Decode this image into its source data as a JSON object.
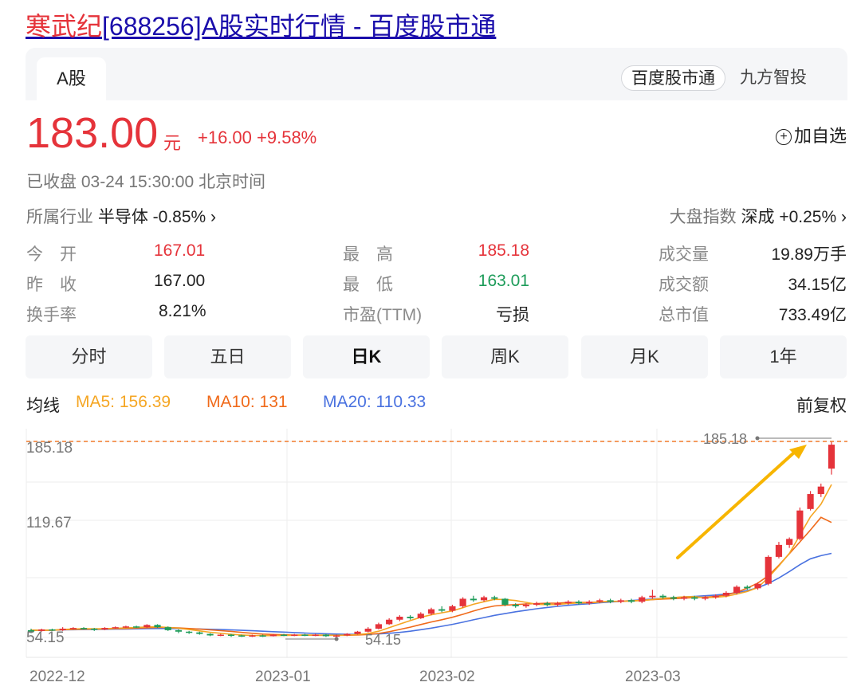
{
  "title": {
    "name": "寒武纪",
    "rest": "[688256]A股实时行情 - 百度股市通"
  },
  "tabs": {
    "active": "A股"
  },
  "sources": {
    "active": "百度股市通",
    "other": "九方智投"
  },
  "quote": {
    "price": "183.00",
    "unit": "元",
    "change": "+16.00 +9.58%",
    "add_watch": "加自选",
    "status": "已收盘  03-24 15:30:00  北京时间",
    "industry_label": "所属行业",
    "industry_value": "半导体 -0.85% ›",
    "index_label": "大盘指数",
    "index_value": "深成 +0.25% ›"
  },
  "stats": {
    "open_label": "今　开",
    "open": "167.01",
    "prev_label": "昨　收",
    "prev": "167.00",
    "turnover_label": "换手率",
    "turnover": "8.21%",
    "high_label": "最　高",
    "high": "185.18",
    "low_label": "最　低",
    "low": "163.01",
    "pe_label": "市盈(TTM)",
    "pe": "亏损",
    "volume_label": "成交量",
    "volume": "19.89万手",
    "amount_label": "成交额",
    "amount": "34.15亿",
    "mcap_label": "总市值",
    "mcap": "733.49亿"
  },
  "periods": [
    "分时",
    "五日",
    "日K",
    "周K",
    "月K",
    "1年"
  ],
  "active_period": "日K",
  "ma_legend": {
    "label": "均线",
    "ma5": "MA5: 156.39",
    "ma10": "MA10: 131",
    "ma20": "MA20: 110.33"
  },
  "adjust": "前复权",
  "colors": {
    "up": "#e5333a",
    "down": "#1e9c5a",
    "ma5": "#f5a623",
    "ma10": "#f06a1a",
    "ma20": "#4a72e0",
    "arrow": "#f7b500"
  },
  "chart_data": {
    "type": "candlestick",
    "y_ticks": [
      "185.18",
      "119.67",
      "54.15"
    ],
    "ylim": [
      54.15,
      185.18
    ],
    "x_ticks": [
      "2022-12",
      "2023-01",
      "2023-02",
      "2023-03"
    ],
    "max_label": "185.18",
    "min_label": "54.15",
    "candles": [
      [
        59,
        58,
        60,
        57
      ],
      [
        58.5,
        59.5,
        60,
        58
      ],
      [
        59.5,
        59,
        60,
        58.5
      ],
      [
        59,
        60,
        61,
        58.5
      ],
      [
        60,
        60.5,
        61,
        59.5
      ],
      [
        60.5,
        60,
        61,
        59.5
      ],
      [
        60,
        59.5,
        60.5,
        58.5
      ],
      [
        59.5,
        60.5,
        61,
        59
      ],
      [
        60.5,
        61,
        61.5,
        60
      ],
      [
        61,
        61.5,
        62,
        60.5
      ],
      [
        61.5,
        61,
        62,
        60.5
      ],
      [
        61,
        62.5,
        63,
        60.5
      ],
      [
        62.5,
        61,
        63,
        60.5
      ],
      [
        61,
        59,
        61.5,
        58.5
      ],
      [
        59,
        58,
        59.5,
        57
      ],
      [
        58,
        57.5,
        58.5,
        56.5
      ],
      [
        57.5,
        56.5,
        58,
        56
      ],
      [
        56.5,
        55.5,
        57,
        55
      ],
      [
        55.5,
        56,
        56.5,
        55
      ],
      [
        56,
        55.5,
        56.5,
        54.5
      ],
      [
        55.5,
        55,
        56,
        54.5
      ],
      [
        55,
        55.5,
        56,
        54.5
      ],
      [
        55.5,
        55,
        56,
        54.5
      ],
      [
        55,
        56,
        56.5,
        54.8
      ],
      [
        56,
        55.5,
        56.5,
        55
      ],
      [
        55.5,
        56,
        56.5,
        55
      ],
      [
        56,
        55.5,
        56.5,
        55
      ],
      [
        55.5,
        56,
        56.5,
        55
      ],
      [
        56,
        55,
        56.5,
        54.5
      ],
      [
        55,
        55.5,
        56,
        54.15
      ],
      [
        55.5,
        56.5,
        57,
        55
      ],
      [
        56.5,
        58,
        58.5,
        56
      ],
      [
        58,
        60,
        61,
        57.5
      ],
      [
        60,
        63,
        64,
        59.5
      ],
      [
        63,
        66,
        67,
        62.5
      ],
      [
        66,
        68,
        69,
        65
      ],
      [
        68,
        67,
        69,
        66
      ],
      [
        67,
        70,
        71,
        66.5
      ],
      [
        70,
        73,
        74,
        69
      ],
      [
        73,
        72,
        75,
        71
      ],
      [
        72,
        75,
        76,
        71
      ],
      [
        75,
        80,
        81,
        74
      ],
      [
        80,
        79,
        82,
        78
      ],
      [
        79,
        81,
        82,
        78
      ],
      [
        81,
        80,
        82,
        79
      ],
      [
        80,
        76,
        80.5,
        75
      ],
      [
        76,
        75,
        77,
        74
      ],
      [
        75,
        76,
        77,
        74
      ],
      [
        76,
        77,
        78,
        75
      ],
      [
        77,
        76,
        78,
        75
      ],
      [
        76,
        77,
        78,
        75
      ],
      [
        77,
        78,
        79,
        76
      ],
      [
        78,
        77,
        79,
        76
      ],
      [
        77,
        78,
        79,
        76
      ],
      [
        78,
        79,
        80,
        77
      ],
      [
        79,
        78,
        80,
        77
      ],
      [
        78,
        79,
        80,
        77
      ],
      [
        79,
        78,
        80,
        77
      ],
      [
        78,
        81,
        82,
        77
      ],
      [
        81,
        82,
        86,
        80
      ],
      [
        82,
        81,
        83,
        80
      ],
      [
        81,
        80,
        82,
        79
      ],
      [
        80,
        81,
        82,
        79
      ],
      [
        81,
        80,
        82,
        79
      ],
      [
        80,
        81,
        82,
        79
      ],
      [
        81,
        82,
        83,
        80
      ],
      [
        82,
        84,
        85,
        81
      ],
      [
        84,
        88,
        89,
        83
      ],
      [
        88,
        87,
        89,
        86
      ],
      [
        87,
        90,
        91,
        86
      ],
      [
        90,
        108,
        109,
        89
      ],
      [
        108,
        116,
        118,
        107
      ],
      [
        116,
        120,
        121,
        114
      ],
      [
        120,
        139,
        141,
        119
      ],
      [
        140,
        150,
        152,
        139
      ],
      [
        150,
        155,
        157,
        148
      ],
      [
        167,
        183,
        185.18,
        163
      ]
    ],
    "ma5": [
      59,
      59,
      59,
      59.5,
      59.8,
      60,
      59.9,
      60,
      60.2,
      60.5,
      60.8,
      61.2,
      61.3,
      60.8,
      60.3,
      59.4,
      58.5,
      57.6,
      56.9,
      56.3,
      55.8,
      55.5,
      55.4,
      55.4,
      55.5,
      55.6,
      55.7,
      55.7,
      55.7,
      55.6,
      55.7,
      56,
      56.8,
      58.3,
      60.7,
      63.1,
      65.4,
      67.6,
      69.3,
      70.6,
      71.9,
      74,
      76.3,
      78,
      79.6,
      79.5,
      78.8,
      77.6,
      76.3,
      76,
      76.2,
      76.8,
      77.2,
      77.2,
      77.8,
      78.2,
      78.4,
      78.6,
      78.8,
      79.5,
      80.3,
      80.8,
      81.3,
      81.4,
      80.7,
      81,
      81.6,
      83.1,
      84.9,
      87.5,
      94.1,
      101.9,
      110.4,
      122.6,
      134.8,
      143.2,
      156.39
    ],
    "ma10": [
      59,
      59,
      59,
      59.3,
      59.5,
      59.7,
      59.7,
      59.8,
      60,
      60.1,
      60.4,
      60.6,
      60.9,
      60.8,
      60.5,
      60.1,
      59.7,
      59.2,
      58.7,
      58.2,
      57.5,
      56.9,
      56.4,
      56.1,
      55.9,
      55.7,
      55.7,
      55.6,
      55.6,
      55.6,
      55.6,
      55.8,
      56.1,
      56.8,
      58,
      59.5,
      61,
      62.8,
      64.5,
      66,
      67.6,
      69.6,
      71.8,
      73.8,
      75.2,
      75.7,
      76.1,
      76.5,
      76.8,
      77,
      77.1,
      77.5,
      77.6,
      77.6,
      77.9,
      78.2,
      78.3,
      78.5,
      78.9,
      79.4,
      79.8,
      80.1,
      80.4,
      80.8,
      81,
      81.6,
      82.6,
      84.4,
      87.1,
      90.5,
      95.3,
      102.4,
      110.2,
      118,
      126,
      134.4,
      131
    ],
    "ma20": [
      59,
      59,
      59,
      59.2,
      59.3,
      59.4,
      59.5,
      59.6,
      59.7,
      59.8,
      59.9,
      60,
      60.1,
      60.1,
      60,
      59.9,
      59.8,
      59.6,
      59.4,
      59.2,
      58.9,
      58.6,
      58.3,
      58,
      57.7,
      57.4,
      57.1,
      56.8,
      56.6,
      56.4,
      56.3,
      56.2,
      56.3,
      56.5,
      56.9,
      57.5,
      58.3,
      59.3,
      60.4,
      61.6,
      62.9,
      64.3,
      65.9,
      67.4,
      68.9,
      70.1,
      71.3,
      72.3,
      73.3,
      74.2,
      74.9,
      75.6,
      76.2,
      76.7,
      77.3,
      77.8,
      78.3,
      78.8,
      79.3,
      79.8,
      80.3,
      80.8,
      81.2,
      81.6,
      82,
      82.5,
      83.1,
      84.1,
      85.5,
      87.4,
      90.2,
      93.9,
      98.2,
      102.8,
      106.7,
      108.8,
      110.33
    ]
  }
}
